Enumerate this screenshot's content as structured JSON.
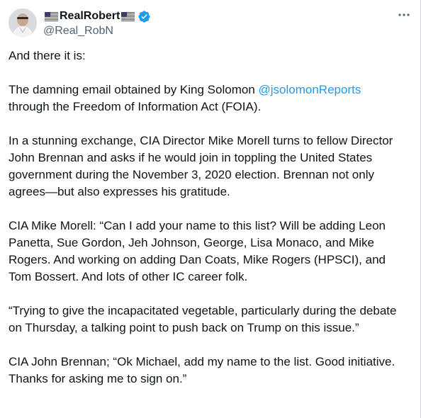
{
  "author": {
    "display_name": "RealRobert",
    "handle": "@Real_RobN",
    "flag_emoji": "us-flag",
    "verified": true,
    "verified_color": "#1d9bf0"
  },
  "menu": {
    "icon": "more-horizontal-icon"
  },
  "tweet": {
    "p1": "And there it is:",
    "p2_before": "The damning email obtained by King Solomon ",
    "p2_mention": "@jsolomonReports",
    "p2_after": "through the Freedom of Information Act (FOIA).",
    "p3": "In a stunning exchange, CIA Director Mike Morell turns to fellow Director John Brennan and asks if he would join in toppling the United States government during the November 3, 2020 election. Brennan not only agrees—but also expresses his gratitude.",
    "p4": "CIA Mike Morell: “Can I add your name to this list? Will be adding Leon Panetta, Sue Gordon, Jeh Johnson, George, Lisa Monaco, and Mike Rogers. And working on adding Dan Coats, Mike Rogers (HPSCI), and Tom Bossert. And lots of other IC career folk.",
    "p5": "“Trying to give the incapacitated vegetable, particularly during the debate on Thursday, a talking point to push back on Trump on this issue.”",
    "p6": "CIA John Brennan; “Ok Michael, add my name to the list. Good initiative. Thanks for asking me to sign on.”"
  }
}
